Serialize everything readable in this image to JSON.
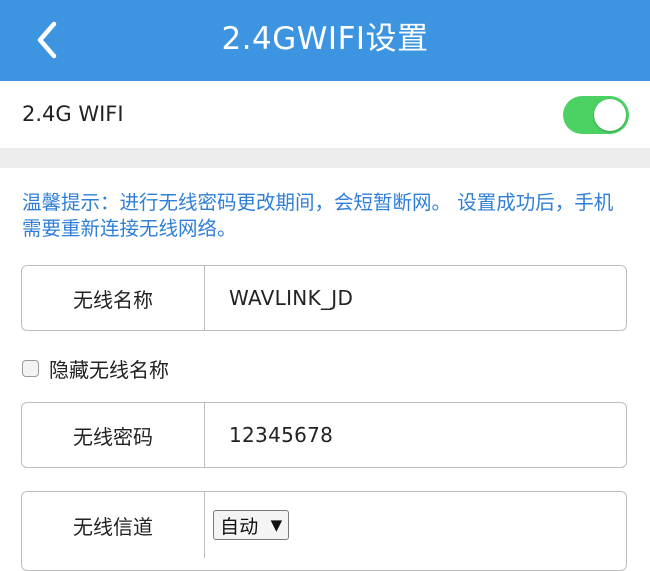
{
  "header": {
    "title": "2.4GWIFI设置",
    "back_icon": "chevron-left-icon",
    "background": "#3d95e2"
  },
  "wifi_toggle": {
    "label": "2.4G WIFI",
    "enabled": true,
    "color_on": "#4cd163"
  },
  "tip": {
    "text": "温馨提示：进行无线密码更改期间，会短暂断网。 设置成功后，手机需要重新连接无线网络。",
    "color": "#2f7fd6"
  },
  "form": {
    "ssid": {
      "label": "无线名称",
      "value": "WAVLINK_JD"
    },
    "hide_ssid": {
      "label": "隐藏无线名称",
      "checked": false
    },
    "password": {
      "label": "无线密码",
      "value": "12345678"
    },
    "channel": {
      "label": "无线信道",
      "selected": "自动",
      "arrow": "▼"
    }
  }
}
